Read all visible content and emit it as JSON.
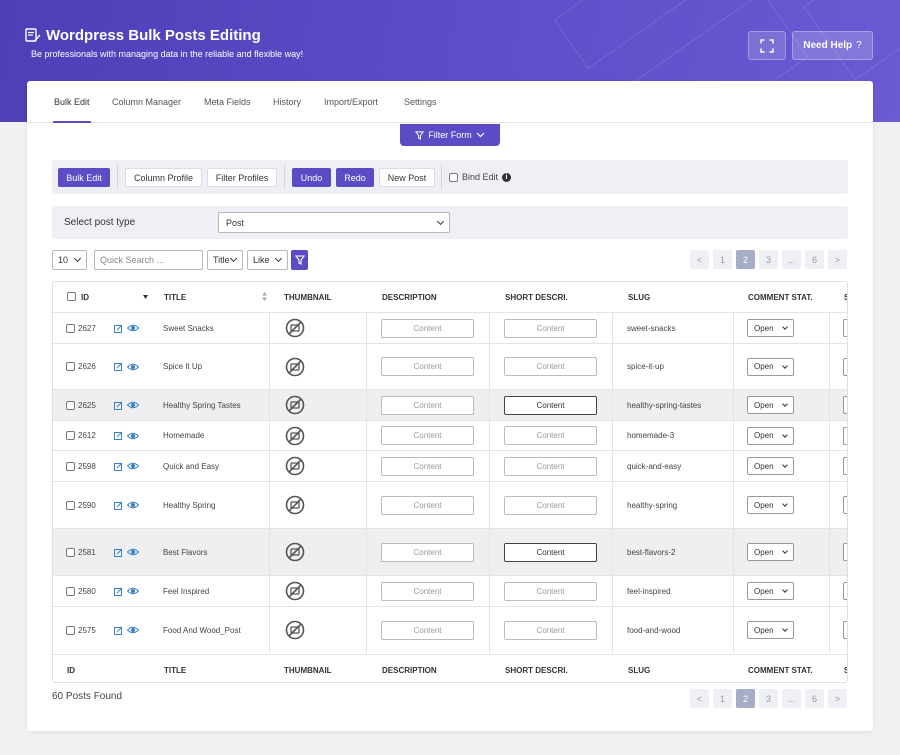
{
  "header": {
    "title": "Wordpress Bulk Posts Editing",
    "subtitle": "Be professionals with managing data in the reliable and flexible way!",
    "help_label": "Need Help",
    "help_icon": "?"
  },
  "tabs": [
    {
      "label": "Bulk Edit"
    },
    {
      "label": "Column Manager"
    },
    {
      "label": "Meta Fields"
    },
    {
      "label": "History"
    },
    {
      "label": "Import/Export"
    },
    {
      "label": "Settings"
    }
  ],
  "filter_form": {
    "label": "Filter Form"
  },
  "toolbar": {
    "bulk_edit": "Bulk Edit",
    "column_profile": "Column Profile",
    "filter_profiles": "Filter Profiles",
    "undo": "Undo",
    "redo": "Redo",
    "new_post": "New Post",
    "bind_edit": "Bind Edit",
    "info": "i"
  },
  "post_type": {
    "label": "Select post type",
    "value": "Post"
  },
  "controls": {
    "per_page": "10",
    "quick_search_placeholder": "Quick Search ...",
    "field": "Title",
    "operator": "Like"
  },
  "pagination": {
    "prev": "<",
    "pages": [
      "1",
      "2",
      "3",
      "...",
      "6"
    ],
    "next": ">",
    "active": "2"
  },
  "table": {
    "headers": {
      "id": "ID",
      "title": "TITLE",
      "thumbnail": "THUMBNAIL",
      "description": "DESCRIPTION",
      "short_description": "SHORT DESCRI.",
      "slug": "SLUG",
      "comment_status": "COMMENT STAT.",
      "extra": "S"
    },
    "content_label": "Content",
    "status_value": "Open",
    "rows": [
      {
        "id": "2627",
        "title": "Sweet Snacks",
        "slug": "sweet-snacks"
      },
      {
        "id": "2626",
        "title": "Spice It Up",
        "slug": "spice-it-up"
      },
      {
        "id": "2625",
        "title": "Healthy Spring Tastes",
        "slug": "healthy-spring-tastes"
      },
      {
        "id": "2612",
        "title": "Homemade",
        "slug": "homemade-3"
      },
      {
        "id": "2598",
        "title": "Quick and Easy",
        "slug": "quick-and-easy"
      },
      {
        "id": "2590",
        "title": "Healthy Spring",
        "slug": "healthy-spring"
      },
      {
        "id": "2581",
        "title": "Best Flavors",
        "slug": "best-flavors-2"
      },
      {
        "id": "2580",
        "title": "Feel Inspired",
        "slug": "feel-inspired"
      },
      {
        "id": "2575",
        "title": "Food And Wood_Post",
        "slug": "food-and-wood"
      }
    ]
  },
  "footer": {
    "found": "60 Posts Found"
  },
  "colors": {
    "accent": "#5b4bc4",
    "header_from": "#4d3fb5",
    "header_to": "#6a5bd3"
  }
}
